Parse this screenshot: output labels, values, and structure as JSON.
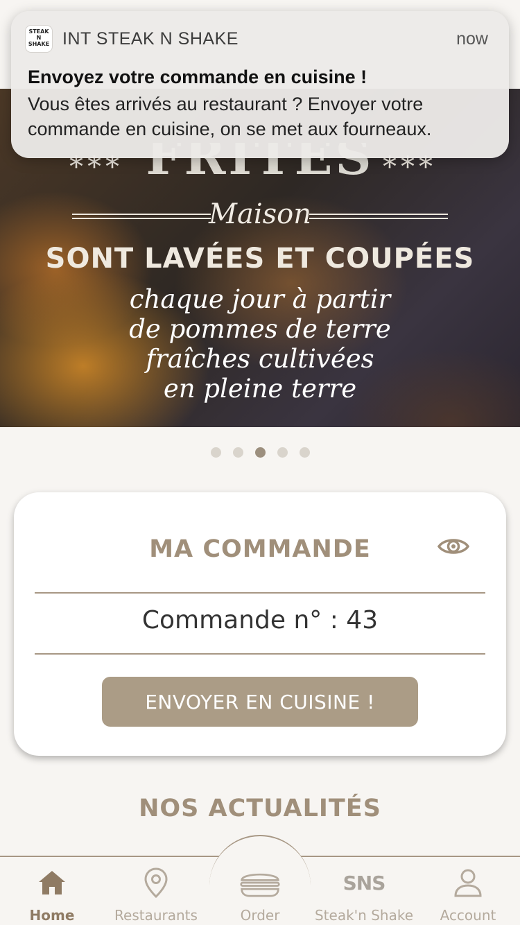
{
  "notification": {
    "app_name": "INT STEAK N SHAKE",
    "time": "now",
    "title": "Envoyez votre commande en cuisine !",
    "body": "Vous êtes arrivés au restaurant ? Envoyer votre commande en cuisine, on se met aux fourneaux.",
    "icon_label": "STEAK N SHAKE"
  },
  "hero": {
    "top_word": "FRITES",
    "script_word": "Maison",
    "headline": "SONT LAVÉES ET COUPÉES",
    "hand_line_1": "chaque jour à partir",
    "hand_line_2": "de pommes de terre",
    "hand_line_3": "fraîches cultivées",
    "hand_line_4": "en pleine terre",
    "stars": "***"
  },
  "carousel": {
    "count": 5,
    "active_index": 2
  },
  "order_card": {
    "title": "MA COMMANDE",
    "order_number": "Commande n° : 43",
    "send_button": "ENVOYER EN CUISINE !",
    "eye_icon": "eye-icon"
  },
  "news": {
    "title": "NOS ACTUALITÉS"
  },
  "tabs": [
    {
      "label": "Home",
      "icon": "home-icon",
      "active": true
    },
    {
      "label": "Restaurants",
      "icon": "map-pin-icon",
      "active": false
    },
    {
      "label": "Order",
      "icon": "burger-icon",
      "active": false
    },
    {
      "label": "Steak'n Shake",
      "icon": "sns-logo-icon",
      "active": false,
      "mark": "SNS"
    },
    {
      "label": "Account",
      "icon": "person-icon",
      "active": false
    }
  ],
  "colors": {
    "accent": "#a08f7a",
    "button": "#ab9c86",
    "tab_active": "#8f7b64",
    "tab_inactive": "#b4aa9d",
    "background": "#f7f5f2"
  }
}
